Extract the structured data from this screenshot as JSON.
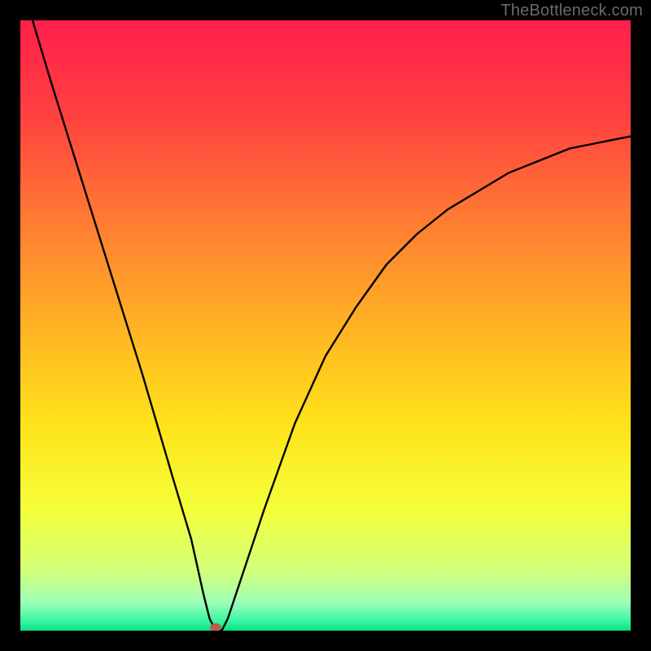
{
  "watermark": "TheBottleneck.com",
  "chart_data": {
    "type": "line",
    "title": "",
    "xlabel": "",
    "ylabel": "",
    "xlim": [
      0,
      100
    ],
    "ylim": [
      0,
      100
    ],
    "series": [
      {
        "name": "bottleneck-curve",
        "x": [
          2,
          5,
          10,
          15,
          20,
          25,
          28,
          30,
          31,
          32,
          33,
          34,
          36,
          40,
          45,
          50,
          55,
          60,
          65,
          70,
          75,
          80,
          85,
          90,
          95,
          100
        ],
        "values": [
          100,
          90,
          74,
          58,
          42,
          25,
          15,
          6,
          2,
          0,
          0,
          2,
          8,
          20,
          34,
          45,
          53,
          60,
          65,
          69,
          72,
          75,
          77,
          79,
          80,
          81
        ]
      }
    ],
    "marker": {
      "x": 32,
      "y": 0,
      "label": "optimal-point"
    },
    "gradient_stops": [
      {
        "offset": 0,
        "color": "#ff1f4b"
      },
      {
        "offset": 0.16,
        "color": "#ff4240"
      },
      {
        "offset": 0.34,
        "color": "#ff7f32"
      },
      {
        "offset": 0.5,
        "color": "#ffb224"
      },
      {
        "offset": 0.66,
        "color": "#ffe21a"
      },
      {
        "offset": 0.8,
        "color": "#f4ff3a"
      },
      {
        "offset": 0.9,
        "color": "#d4ff78"
      },
      {
        "offset": 0.955,
        "color": "#9cffb8"
      },
      {
        "offset": 0.985,
        "color": "#34f5a3"
      },
      {
        "offset": 1.0,
        "color": "#0be081"
      }
    ]
  }
}
